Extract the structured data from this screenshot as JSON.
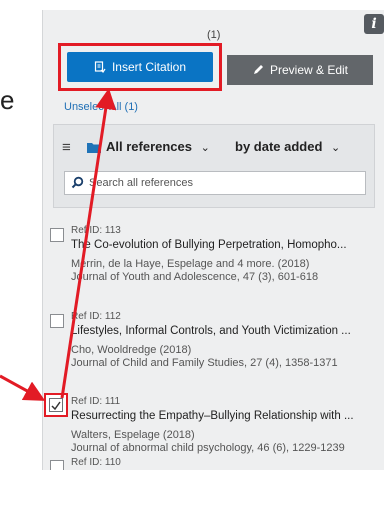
{
  "left_fragment": "e",
  "header": {
    "count": "(1)",
    "info_glyph": "i",
    "insert_citation_label": "Insert Citation",
    "preview_edit_label": "Preview & Edit",
    "unselect_label": "Unselect All (1)"
  },
  "toolbar": {
    "collection_label": "All references",
    "sort_label": "by date added",
    "search_placeholder": "Search all references"
  },
  "references": [
    {
      "ref_id": "Ref ID: 113",
      "title": "The Co-evolution of Bullying Perpetration, Homopho...",
      "authors": "Merrin, de la Haye, Espelage and 4 more. (2018)",
      "journal": "Journal of Youth and Adolescence, 47 (3), 601-618",
      "checked": false
    },
    {
      "ref_id": "Ref ID: 112",
      "title": "Lifestyles, Informal Controls, and Youth Victimization ...",
      "authors": "Cho, Wooldredge (2018)",
      "journal": "Journal of Child and Family Studies, 27 (4), 1358-1371",
      "checked": false
    },
    {
      "ref_id": "Ref ID: 111",
      "title": "Resurrecting the Empathy–Bullying Relationship with ...",
      "authors": "Walters, Espelage (2018)",
      "journal": "Journal of abnormal child psychology, 46 (6), 1229-1239",
      "checked": true
    },
    {
      "ref_id": "Ref ID: 110",
      "title": "",
      "authors": "",
      "journal": "",
      "checked": false
    }
  ],
  "colors": {
    "primary_button": "#0a74c4",
    "secondary_button": "#62666a",
    "highlight": "#e21b25",
    "link": "#1f6fb5"
  }
}
